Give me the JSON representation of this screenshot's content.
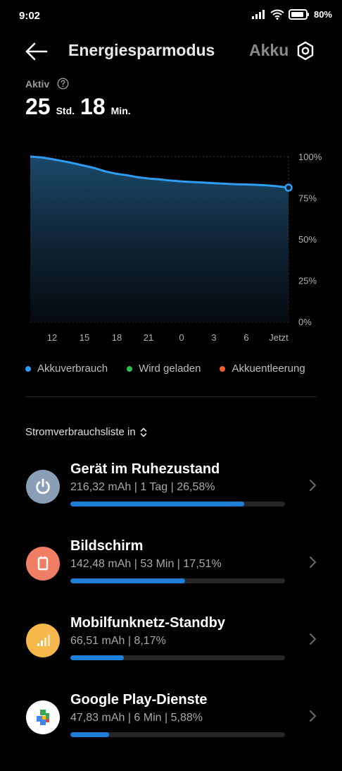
{
  "status_bar": {
    "time": "9:02",
    "battery_percent": "80%",
    "icons": [
      "signal-icon",
      "wifi-icon",
      "battery-icon"
    ]
  },
  "header": {
    "title": "Energiesparmodus",
    "next_tab": "Akku",
    "back_icon": "back-arrow-icon",
    "settings_icon": "gear-icon"
  },
  "active": {
    "label": "Aktiv",
    "hours": "25",
    "hours_unit": "Std.",
    "minutes": "18",
    "minutes_unit": "Min."
  },
  "chart_data": {
    "type": "area",
    "y_tick_labels": [
      "100%",
      "75%",
      "50%",
      "25%",
      "0%"
    ],
    "x_tick_labels": [
      "12",
      "15",
      "18",
      "21",
      "0",
      "3",
      "6",
      "Jetzt"
    ],
    "ylim": [
      0,
      100
    ],
    "series": [
      {
        "name": "Akkuverbrauch",
        "color": "#2e9cf0",
        "x": [
          0,
          1,
          2,
          3,
          4,
          5,
          6,
          7,
          8,
          9,
          10,
          11,
          12,
          13,
          14,
          15,
          16,
          17,
          18,
          19,
          20,
          21,
          22,
          23,
          24
        ],
        "values": [
          100,
          99.5,
          98.5,
          97.3,
          96,
          94.5,
          93,
          91,
          89.6,
          88.7,
          87.5,
          86.7,
          86.2,
          85.5,
          85,
          84.6,
          84.3,
          83.9,
          83.6,
          83.3,
          83.1,
          82.9,
          82.6,
          82.0,
          81.2
        ]
      }
    ],
    "grid": true
  },
  "legend": [
    {
      "label": "Akkuverbrauch",
      "color": "#2e9cf0"
    },
    {
      "label": "Wird geladen",
      "color": "#2ec04f"
    },
    {
      "label": "Akkuentleerung",
      "color": "#f0602a"
    }
  ],
  "list": {
    "heading": "Stromverbrauchsliste in",
    "items": [
      {
        "title": "Gerät im Ruhezustand",
        "subtitle": "216,32 mAh | 1 Tag  | 26,58%",
        "percent": 26.58,
        "icon": "power-icon",
        "icon_bg": "#8a9fb6"
      },
      {
        "title": "Bildschirm",
        "subtitle": "142,48 mAh | 53 Min  | 17,51%",
        "percent": 17.51,
        "icon": "screen-icon",
        "icon_bg": "#f07e64"
      },
      {
        "title": "Mobilfunknetz-Standby",
        "subtitle": "66,51 mAh | 8,17%",
        "percent": 8.17,
        "icon": "cellular-signal-icon",
        "icon_bg": "#f6b84a"
      },
      {
        "title": "Google Play-Dienste",
        "subtitle": "47,83 mAh | 6 Min  | 5,88%",
        "percent": 5.88,
        "icon": "google-play-services-icon",
        "icon_bg": "#ffffff"
      }
    ]
  }
}
